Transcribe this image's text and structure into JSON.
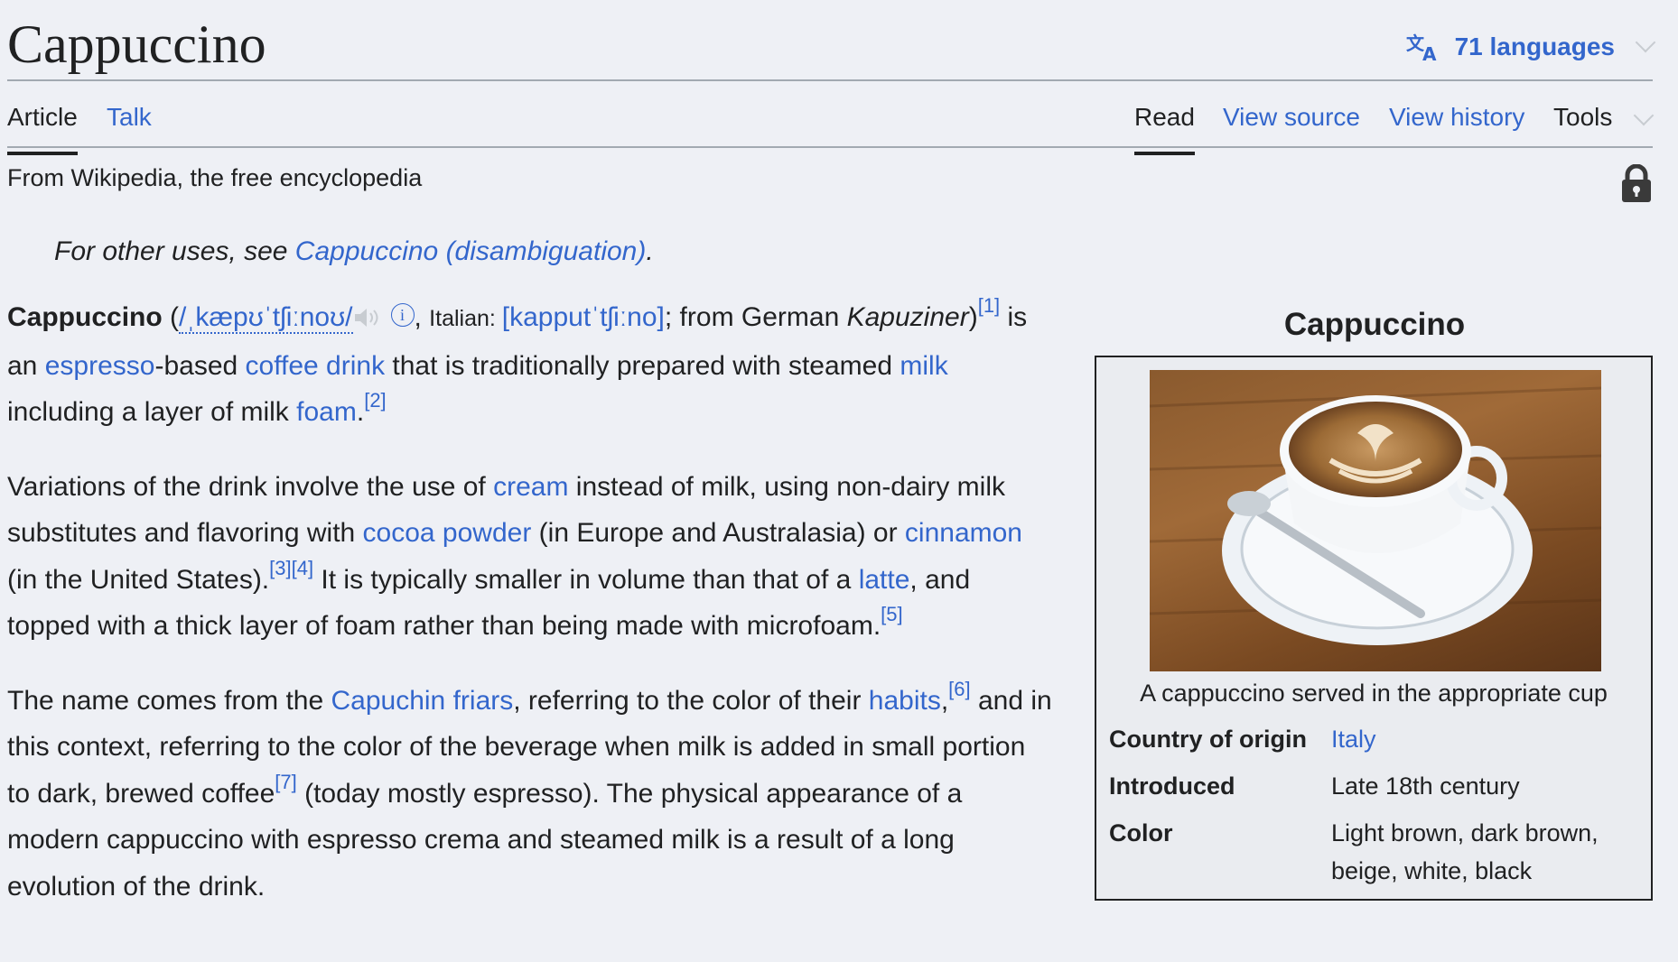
{
  "header": {
    "title": "Cappuccino",
    "languages_label": "71 languages"
  },
  "tabs": {
    "left": [
      {
        "label": "Article",
        "active": true
      },
      {
        "label": "Talk",
        "active": false
      }
    ],
    "right": [
      {
        "label": "Read",
        "active": true
      },
      {
        "label": "View source",
        "active": false
      },
      {
        "label": "View history",
        "active": false
      },
      {
        "label": "Tools",
        "active": false
      }
    ]
  },
  "tagline": "From Wikipedia, the free encyclopedia",
  "hatnote": {
    "prefix": "For other uses, see ",
    "link": "Cappuccino (disambiguation)",
    "suffix": "."
  },
  "lead": {
    "bold": "Cappuccino",
    "ipa_open": " (",
    "ipa": "/ˌkæpʊˈtʃiːnoʊ/",
    "italian_label": "Italian: ",
    "italian_ipa": "[kapputˈtʃiːno]",
    "from_german": "; from German",
    "kapuziner": "Kapuziner",
    "close_paren": ")",
    "ref1": "[1]",
    "t1": " is an ",
    "espresso": "espresso",
    "t2": "-based ",
    "coffee_drink": "coffee drink",
    "t3": " that is traditionally prepared with steamed ",
    "milk": "milk",
    "t4": " including a layer of milk ",
    "foam": "foam",
    "t5": ".",
    "ref2": "[2]"
  },
  "para2": {
    "t1": "Variations of the drink involve the use of ",
    "cream": "cream",
    "t2": " instead of milk, using non-dairy milk substitutes and flavoring with ",
    "cocoa": "cocoa powder",
    "t3": " (in Europe and Australasia) or ",
    "cinnamon": "cinnamon",
    "t4": " (in the United States).",
    "ref3": "[3]",
    "ref4": "[4]",
    "t5": " It is typically smaller in volume than that of a ",
    "latte": "latte",
    "t6": ", and topped with a thick layer of foam rather than being made with microfoam.",
    "ref5": "[5]"
  },
  "para3": {
    "t1": "The name comes from the ",
    "capuchin": "Capuchin friars",
    "t2": ", referring to the color of their ",
    "habits": "habits",
    "t3": ",",
    "ref6": "[6]",
    "t4": " and in this context, referring to the color of the beverage when milk is added in small portion to dark, brewed coffee",
    "ref7": "[7]",
    "t5": " (today mostly espresso). The physical appearance of a modern cappuccino with espresso crema and steamed milk is a result of a long evolution of the drink."
  },
  "infobox": {
    "title": "Cappuccino",
    "image_caption": "A cappuccino served in the appropriate cup",
    "rows": [
      {
        "label": "Country of origin",
        "value": "Italy",
        "link": true
      },
      {
        "label": "Introduced",
        "value": "Late 18th century",
        "link": false
      },
      {
        "label": "Color",
        "value": "Light brown, dark brown, beige, white, black",
        "link": false
      }
    ]
  },
  "colors": {
    "link": "#3366cc",
    "text": "#202122",
    "background": "#eef0f5",
    "border": "#a2a9b1"
  },
  "icons": [
    "translate-icon",
    "chevron-down-icon",
    "lock-icon",
    "speaker-icon",
    "info-icon"
  ]
}
